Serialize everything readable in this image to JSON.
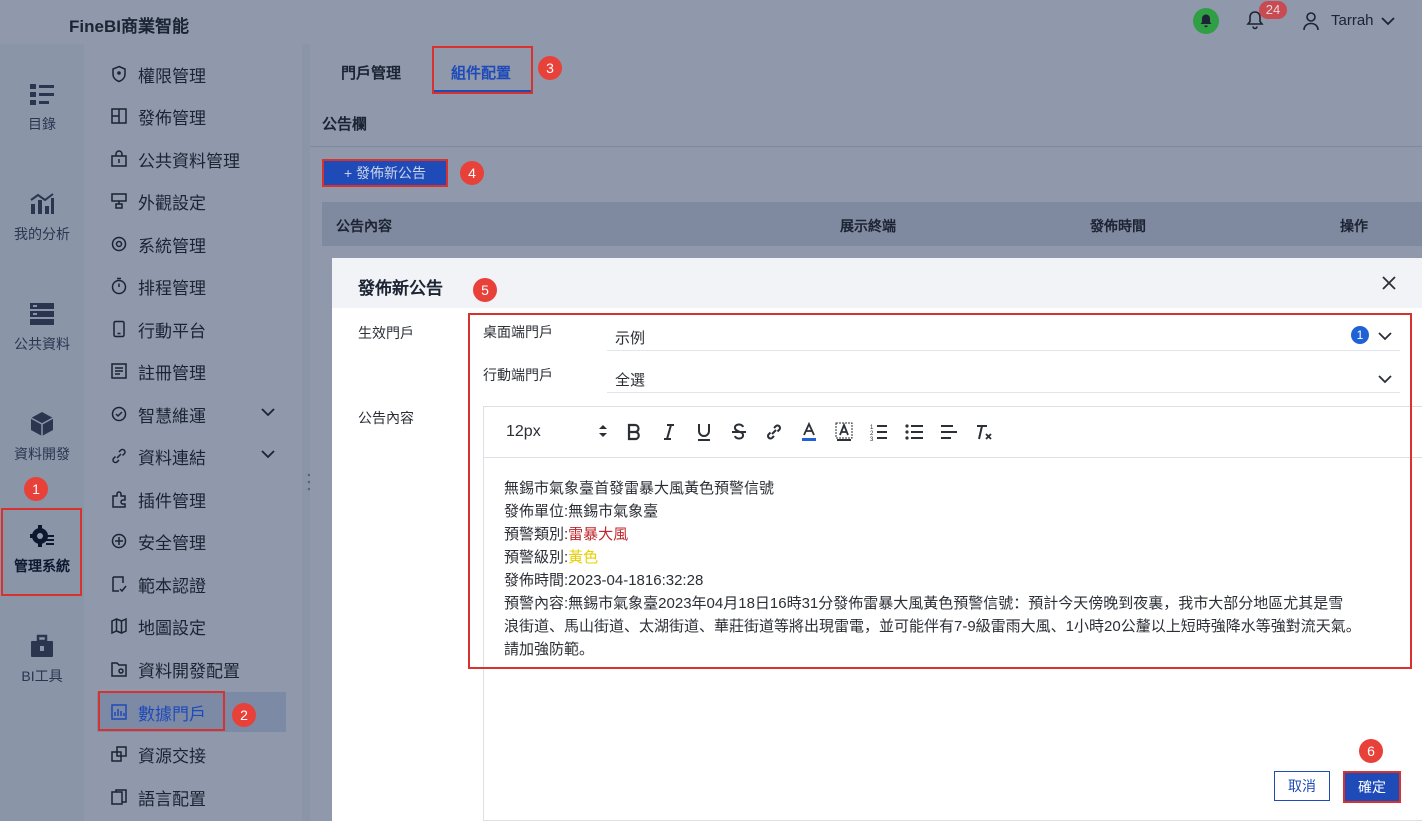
{
  "app": {
    "brand": "FineBI商業智能",
    "notif_count": "24",
    "user_name": "Tarrah"
  },
  "rail": {
    "items": [
      {
        "label": "目錄",
        "icon": "catalog-icon"
      },
      {
        "label": "我的分析",
        "icon": "analysis-icon"
      },
      {
        "label": "公共資料",
        "icon": "public-data-icon"
      },
      {
        "label": "資料開發",
        "icon": "data-dev-icon"
      },
      {
        "label": "管理系統",
        "icon": "gear-icon"
      },
      {
        "label": "BI工具",
        "icon": "toolbox-icon"
      }
    ]
  },
  "menu": {
    "items": [
      {
        "label": "權限管理",
        "icon": "shield-icon"
      },
      {
        "label": "發佈管理",
        "icon": "publish-icon"
      },
      {
        "label": "公共資料管理",
        "icon": "folder-lock-icon"
      },
      {
        "label": "外觀設定",
        "icon": "appearance-icon"
      },
      {
        "label": "系統管理",
        "icon": "settings-icon"
      },
      {
        "label": "排程管理",
        "icon": "timer-icon"
      },
      {
        "label": "行動平台",
        "icon": "mobile-icon"
      },
      {
        "label": "註冊管理",
        "icon": "register-icon"
      },
      {
        "label": "智慧維運",
        "icon": "ops-icon"
      },
      {
        "label": "資料連結",
        "icon": "link-icon"
      },
      {
        "label": "插件管理",
        "icon": "plugin-icon"
      },
      {
        "label": "安全管理",
        "icon": "security-icon"
      },
      {
        "label": "範本認證",
        "icon": "template-cert-icon"
      },
      {
        "label": "地圖設定",
        "icon": "map-icon"
      },
      {
        "label": "資料開發配置",
        "icon": "data-config-icon"
      },
      {
        "label": "數據門戶",
        "icon": "portal-icon"
      },
      {
        "label": "資源交接",
        "icon": "handover-icon"
      },
      {
        "label": "語言配置",
        "icon": "language-icon"
      }
    ]
  },
  "tabs": [
    {
      "label": "門戶管理"
    },
    {
      "label": "組件配置"
    }
  ],
  "section_title": "公告欄",
  "publish_button": "+ 發佈新公告",
  "table": {
    "columns": [
      "公告內容",
      "展示終端",
      "發佈時間",
      "操作"
    ]
  },
  "markers": [
    "1",
    "2",
    "3",
    "4",
    "5",
    "6"
  ],
  "dialog": {
    "title": "發佈新公告",
    "effective_portal_label": "生效門戶",
    "content_label": "公告內容",
    "desktop_label": "桌面端門戶",
    "desktop_value": "示例",
    "desktop_count": "1",
    "mobile_label": "行動端門戶",
    "mobile_value": "全選",
    "toolbar": {
      "font_size": "12px"
    },
    "body": {
      "line1": "無錫市氣象臺首發雷暴大風黃色預警信號",
      "line2": "發佈單位:無錫市氣象臺",
      "line3_prefix": "預警類別:",
      "line3_value": "雷暴大風",
      "line4_prefix": "預警級別:",
      "line4_value": "黃色",
      "line5": "發佈時間:2023-04-1816:32:28",
      "line6": "預警內容:無錫市氣象臺2023年04月18日16時31分發佈雷暴大風黃色預警信號：預計今天傍晚到夜裏，我市大部分地區尤其是雪",
      "line7": "浪街道、馬山街道、太湖街道、華莊街道等將出現雷電，並可能伴有7-9級雷雨大風、1小時20公釐以上短時強降水等強對流天氣。",
      "line8": "請加強防範。"
    },
    "cancel": "取消",
    "ok": "確定"
  },
  "colors": {
    "accent": "#1f4bb8",
    "highlight_box": "#d8322f",
    "marker": "#e8413a",
    "warning_red": "#c0262b",
    "warning_yellow": "#e8d000"
  }
}
